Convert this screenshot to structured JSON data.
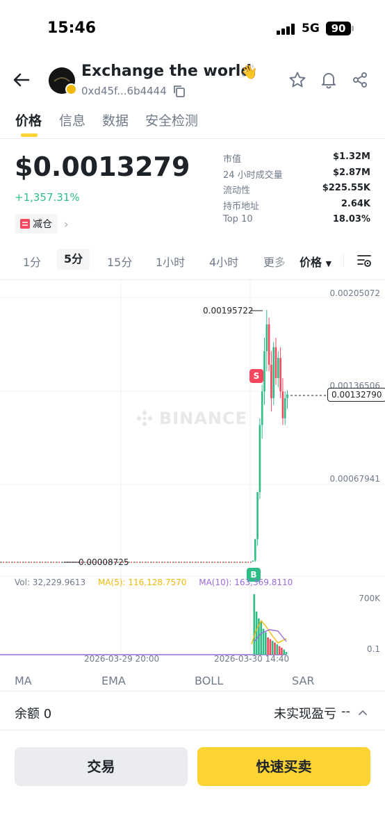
{
  "status_bar": {
    "time": "15:46",
    "network": "5G",
    "battery": "90"
  },
  "header": {
    "token_name": "Exchange the world",
    "token_address": "0xd45f...6b4444",
    "emoji": "👋"
  },
  "tabs": [
    {
      "label": "价格",
      "active": true
    },
    {
      "label": "信息",
      "active": false
    },
    {
      "label": "数据",
      "active": false
    },
    {
      "label": "安全检测",
      "active": false
    }
  ],
  "summary": {
    "price": "$0.0013279",
    "change": "+1,357.31%",
    "chip_label": "减仓",
    "change_color": "#2ebd85"
  },
  "stats": [
    {
      "label": "市值",
      "value": "$1.32M"
    },
    {
      "label": "24 小时成交量",
      "value": "$2.87M"
    },
    {
      "label": "流动性",
      "value": "$225.55K"
    },
    {
      "label": "持币地址",
      "value": "2.64K"
    },
    {
      "label": "Top 10",
      "value": "18.03%"
    }
  ],
  "intervals": [
    {
      "label": "1分",
      "active": false
    },
    {
      "label": "5分",
      "active": true
    },
    {
      "label": "15分",
      "active": false
    },
    {
      "label": "1小时",
      "active": false
    },
    {
      "label": "4小时",
      "active": false
    }
  ],
  "interval_more": "更多",
  "price_type": "价格",
  "chart": {
    "watermark": "BINANCE",
    "y_labels": [
      "0.00205072",
      "0.00136506",
      "0.00067941"
    ],
    "current_price": "0.00132790",
    "high_label": "0.00195722",
    "low_label": "0.00008725",
    "sell_marker": "S",
    "buy_marker": "B",
    "vol_text": "Vol: 32,229.9613",
    "ma5_text": "MA(5): 116,128.7570",
    "ma10_text": "MA(10): 163,369.8110",
    "vol_axis": [
      "700K",
      "0.1"
    ],
    "x_labels": [
      "2026-03-29 20:00",
      "2026-03-30 14:40"
    ],
    "up_color": "#2ebd85",
    "down_color": "#f6465d",
    "ma5_color": "#f0b90b",
    "ma10_color": "#9c6ade"
  },
  "chart_data": {
    "type": "candlestick",
    "ylim": [
      0,
      0.00205072
    ],
    "y_ticks": [
      0.00067941,
      0.00136506,
      0.00205072
    ],
    "x_tick_labels": [
      "2026-03-29 20:00",
      "2026-03-30 14:40"
    ],
    "annotations": {
      "high": 0.00195722,
      "low": 8.725e-05,
      "last": 0.0013279
    },
    "candles": [
      {
        "o": 8.725e-05,
        "h": 9e-05,
        "l": 8e-05,
        "c": 9e-05
      },
      {
        "o": 9e-05,
        "h": 0.00025,
        "l": 8e-05,
        "c": 0.00025
      },
      {
        "o": 0.00025,
        "h": 0.0006,
        "l": 0.0002,
        "c": 0.0006
      },
      {
        "o": 0.0006,
        "h": 0.00115,
        "l": 0.00055,
        "c": 0.0011
      },
      {
        "o": 0.0011,
        "h": 0.0014,
        "l": 0.001,
        "c": 0.00135
      },
      {
        "o": 0.00135,
        "h": 0.00175,
        "l": 0.00125,
        "c": 0.00165
      },
      {
        "o": 0.00165,
        "h": 0.00195722,
        "l": 0.0015,
        "c": 0.00185
      },
      {
        "o": 0.00185,
        "h": 0.0019,
        "l": 0.0015,
        "c": 0.00155
      },
      {
        "o": 0.00155,
        "h": 0.00165,
        "l": 0.0012,
        "c": 0.0013
      },
      {
        "o": 0.0013,
        "h": 0.00172,
        "l": 0.00125,
        "c": 0.00168
      },
      {
        "o": 0.00168,
        "h": 0.00175,
        "l": 0.0014,
        "c": 0.00145
      },
      {
        "o": 0.00145,
        "h": 0.00165,
        "l": 0.00138,
        "c": 0.0016
      },
      {
        "o": 0.0016,
        "h": 0.00168,
        "l": 0.0013,
        "c": 0.00135
      },
      {
        "o": 0.00135,
        "h": 0.00145,
        "l": 0.0011,
        "c": 0.00115
      },
      {
        "o": 0.00115,
        "h": 0.00135,
        "l": 0.0011,
        "c": 0.0013
      },
      {
        "o": 0.0013,
        "h": 0.00136,
        "l": 0.00122,
        "c": 0.0013279
      }
    ],
    "volume": [
      0.1,
      700000,
      500000,
      420000,
      380000,
      300000,
      260000,
      200000,
      180000,
      160000,
      140000,
      120000,
      100000,
      80000,
      60000,
      32229.9613
    ]
  },
  "indicators": [
    "MA",
    "EMA",
    "BOLL",
    "SAR"
  ],
  "footer": {
    "balance": "余额 0",
    "pnl_label": "未实现盈亏",
    "pnl_value": "--",
    "trade_button": "交易",
    "quick_button": "快速买卖"
  }
}
